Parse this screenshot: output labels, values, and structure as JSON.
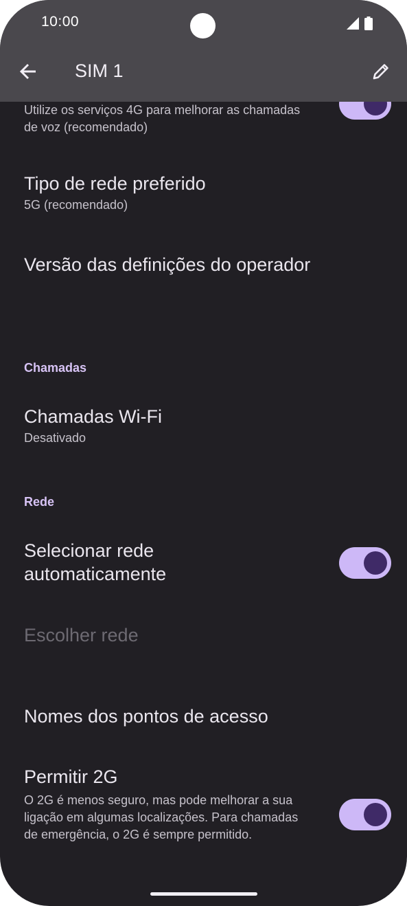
{
  "status_bar": {
    "time": "10:00",
    "icons": [
      "signal-icon",
      "battery-icon"
    ]
  },
  "appbar": {
    "title": "SIM 1",
    "back_icon": "arrow-back-icon",
    "edit_icon": "pencil-icon"
  },
  "settings": {
    "volte": {
      "summary": "Utilize os serviços 4G para melhorar as chamadas de voz (recomendado)",
      "enabled": true
    },
    "preferred_network": {
      "title": "Tipo de rede preferido",
      "summary": "5G (recomendado)"
    },
    "carrier_settings": {
      "title": "Versão das definições do operador"
    },
    "calls_section": {
      "header": "Chamadas"
    },
    "wifi_calling": {
      "title": "Chamadas Wi-Fi",
      "summary": "Desativado"
    },
    "network_section": {
      "header": "Rede"
    },
    "auto_network": {
      "title": "Selecionar rede automaticamente",
      "enabled": true
    },
    "choose_network": {
      "title": "Escolher rede",
      "disabled": true
    },
    "apn": {
      "title": "Nomes dos pontos de acesso"
    },
    "allow_2g": {
      "title": "Permitir 2G",
      "summary": "O 2G é menos seguro, mas pode melhorar a sua ligação em algumas localizações. Para chamadas de emergência, o 2G é sempre permitido.",
      "enabled": true
    }
  },
  "colors": {
    "background": "#211f24",
    "appbar": "#4a484d",
    "accent": "#cdb8f7",
    "section_header": "#d7c3f5"
  }
}
